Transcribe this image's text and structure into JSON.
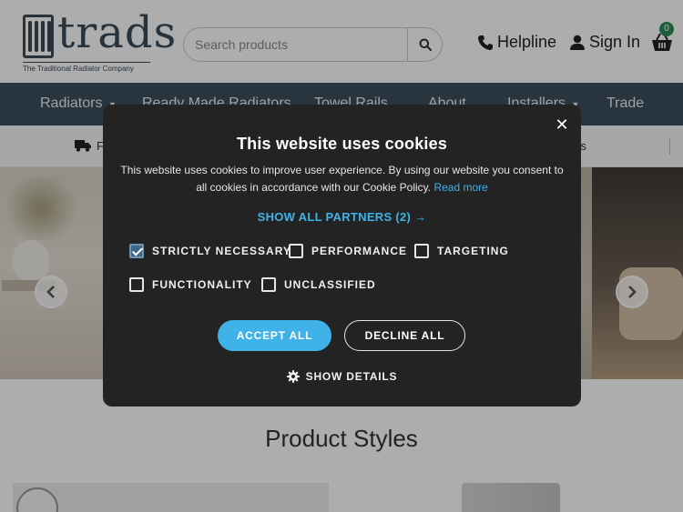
{
  "header": {
    "logo_text": "trads",
    "logo_tagline": "The Traditional Radiator Company",
    "search_placeholder": "Search products",
    "helpline_label": "Helpline",
    "signin_label": "Sign In",
    "basket_count": "0"
  },
  "nav": {
    "items": [
      {
        "label": "Radiators",
        "has_dropdown": true
      },
      {
        "label": "Ready Made Radiators",
        "has_dropdown": false
      },
      {
        "label": "Towel Rails",
        "has_dropdown": false
      },
      {
        "label": "About",
        "has_dropdown": false
      },
      {
        "label": "Installers",
        "has_dropdown": true
      },
      {
        "label": "Trade",
        "has_dropdown": false
      }
    ]
  },
  "usp": {
    "left_text": "F",
    "right_text": "rs"
  },
  "main": {
    "section_title": "Product Styles"
  },
  "cookie_modal": {
    "title": "This website uses cookies",
    "description": "This website uses cookies to improve user experience. By using our website you consent to all cookies in accordance with our Cookie Policy.",
    "read_more_label": "Read more",
    "partners_label": "SHOW ALL PARTNERS (2) →",
    "checkboxes": [
      {
        "label": "STRICTLY NECESSARY",
        "checked": true
      },
      {
        "label": "PERFORMANCE",
        "checked": false
      },
      {
        "label": "TARGETING",
        "checked": false
      },
      {
        "label": "FUNCTIONALITY",
        "checked": false
      },
      {
        "label": "UNCLASSIFIED",
        "checked": false
      }
    ],
    "accept_label": "ACCEPT ALL",
    "decline_label": "DECLINE ALL",
    "show_details_label": "SHOW DETAILS",
    "close_symbol": "✕"
  },
  "colors": {
    "nav_bg": "#3c4e5c",
    "accent_blue": "#3fb3e8",
    "modal_bg": "#232323",
    "brand_dark": "#3a4a57"
  }
}
